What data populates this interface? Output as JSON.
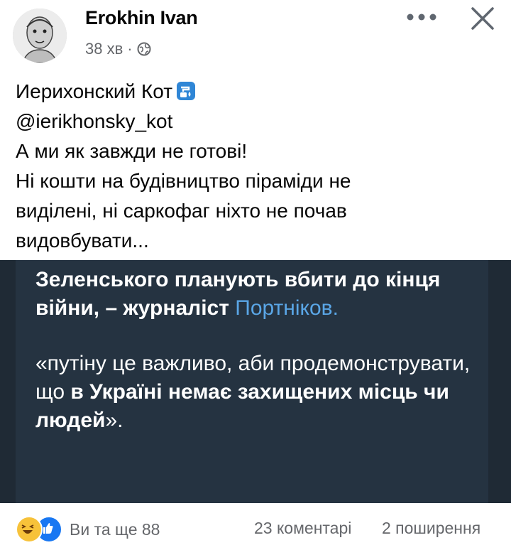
{
  "post": {
    "author": "Erokhin Ivan",
    "time": "38 хв",
    "separator": "·",
    "privacy_icon": "globe-icon"
  },
  "toolbar": {
    "more_icon": "more-dots-icon",
    "close_icon": "close-icon"
  },
  "text": {
    "line1": "Иерихонский Кот",
    "line1_emoji": "potable-water-icon",
    "line2": "@ierikhonsky_kot",
    "line3": "А ми як завжди не готові!",
    "line4": "Ні кошти на будівництво піраміди не",
    "line5": "виділені, ні саркофаг ніхто не почав",
    "line6": "видовбувати..."
  },
  "image": {
    "headline_part1": "Зеленського планують вбити до кінця війни, – журналіст ",
    "headline_link": "Портніков.",
    "quote_part1": "«путіну це важливо, аби продемонструвати, що ",
    "quote_bold": "в Україні немає захищених місць чи людей",
    "quote_end": "»."
  },
  "footer": {
    "reactions_label": "Ви та ще 88",
    "comments": "23 коментарі",
    "shares": "2 поширення"
  },
  "colors": {
    "image_background": "#253341",
    "link": "#5aa6e6",
    "like": "#1877f2",
    "haha": "#f7c23a"
  }
}
